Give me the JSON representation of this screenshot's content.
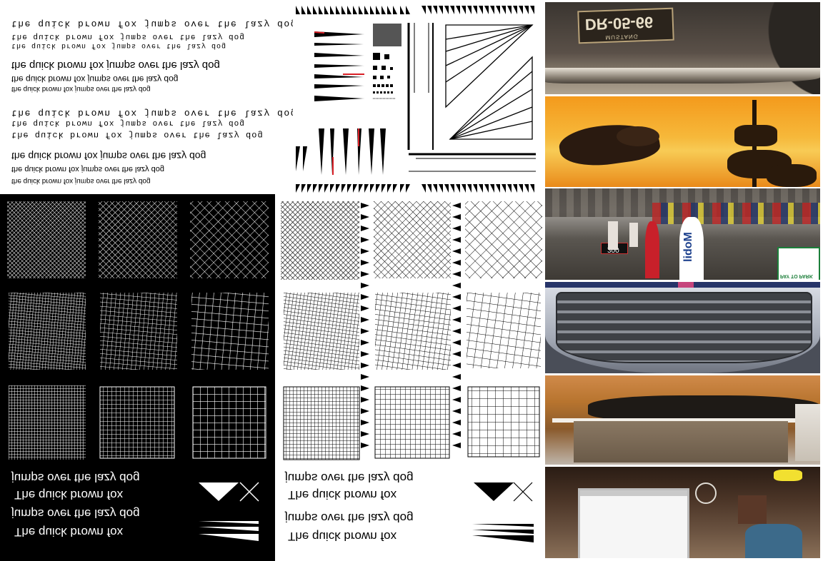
{
  "colors": {
    "black": "#000000",
    "white": "#ffffff",
    "accent_red": "#d81f26",
    "sky_orange": "#f2a21e",
    "garage_grey": "#8a8a8a"
  },
  "text_samples": {
    "pangram_lower": "the quick brown fox jumps over the lazy dog",
    "line_a": "jumps over the lazy dog",
    "line_b": "The quick brown fox"
  },
  "photo_strip": {
    "license_plate": "DR-05-66",
    "plate_header": "MUSTANG",
    "sign_speed": "200",
    "sign_brand": "Mobil",
    "sign_parking": "PAY TO PARK"
  },
  "icons": [
    "triangle-icon",
    "x-cross-icon",
    "wedge-lines-icon"
  ]
}
